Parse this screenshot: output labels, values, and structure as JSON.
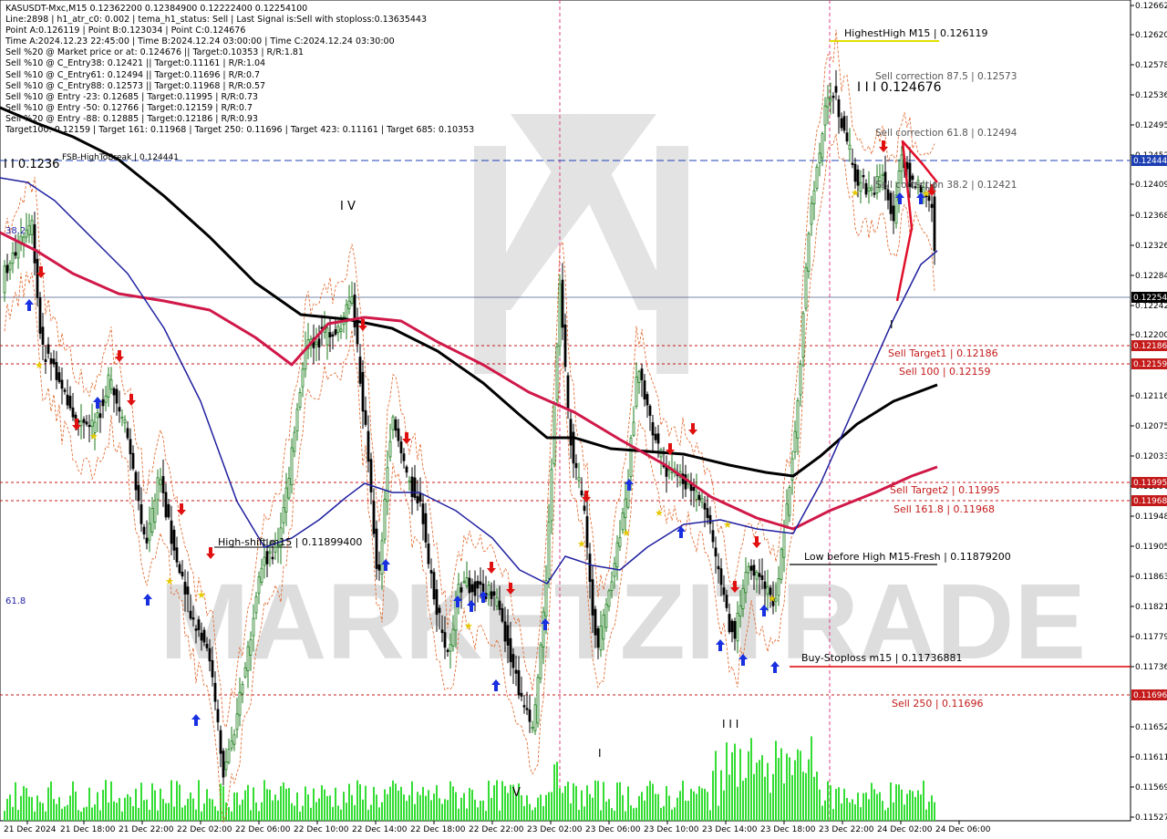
{
  "chart_title": "KASUSDT-Mxc,M15",
  "info_lines": [
    "KASUSDT-Mxc,M15  0.12362200 0.12384900 0.12222400 0.12254100",
    "Line:2898  | h1_atr_c0: 0.002  | tema_h1_status: Sell  | Last Signal is:Sell with stoploss:0.13635443",
    "Point A:0.126119 | Point B:0.123034 | Point C:0.124676",
    "Time A:2024.12.23 22:45:00 | Time B:2024.12.24 03:00:00 | Time C:2024.12.24 03:30:00",
    "Sell %20 @ Market price or at: 0.124676 || Target:0.10353 | R/R:1.81",
    "Sell %10 @ C_Entry38: 0.12421 || Target:0.11161 | R/R:1.04",
    "Sell %10 @ C_Entry61: 0.12494 || Target:0.11696 | R/R:0.7",
    "Sell %10 @ C_Entry88: 0.12573 || Target:0.11968 | R/R:0.57",
    "Sell %10 @ Entry -23: 0.12685 | Target:0.11995 | R/R:0.73",
    "Sell %10 @ Entry -50: 0.12766 | Target:0.12159 | R/R:0.7",
    "Sell %20 @ Entry -88: 0.12885 | Target:0.12186 | R/R:0.93",
    "Target100: 0.12159 | Target 161: 0.11968 | Target 250: 0.11696 | Target 423: 0.11161 | Target 685: 0.10353"
  ],
  "price_axis": {
    "labels": [
      "0.12662",
      "0.12620",
      "0.12578",
      "0.12536",
      "0.12495",
      "0.12452",
      "0.12409",
      "0.12368",
      "0.12326",
      "0.12284",
      "0.12242",
      "0.12200",
      "0.12116",
      "0.12075",
      "0.12033",
      "0.11990",
      "0.11948",
      "0.11905",
      "0.11863",
      "0.11821",
      "0.11779",
      "0.11736",
      "0.11652",
      "0.11611",
      "0.11569",
      "0.11527"
    ],
    "badges": [
      {
        "text": "0.12444",
        "color": "#1c3fb3"
      },
      {
        "text": "0.12254",
        "color": "#000000"
      },
      {
        "text": "0.12186",
        "color": "#c41a1a"
      },
      {
        "text": "0.12159",
        "color": "#c41a1a"
      },
      {
        "text": "0.11995",
        "color": "#c41a1a"
      },
      {
        "text": "0.11968",
        "color": "#c41a1a"
      },
      {
        "text": "0.11696",
        "color": "#c41a1a"
      }
    ]
  },
  "time_axis": {
    "labels": [
      "21 Dec 2024",
      "21 Dec 18:00",
      "21 Dec 22:00",
      "22 Dec 02:00",
      "22 Dec 06:00",
      "22 Dec 10:00",
      "22 Dec 14:00",
      "22 Dec 18:00",
      "22 Dec 22:00",
      "23 Dec 02:00",
      "23 Dec 06:00",
      "23 Dec 10:00",
      "23 Dec 14:00",
      "23 Dec 18:00",
      "23 Dec 22:00",
      "24 Dec 02:00",
      "24 Dec 06:00"
    ]
  },
  "annotations": {
    "highest_high": "HighestHigh   M15 | 0.126119",
    "point_c": "I I I 0.124676",
    "sell_corr_875": "Sell correction 87.5 | 0.12573",
    "sell_corr_618": "Sell correction 61.8 | 0.12494",
    "sell_corr_382": "Sell correction 38.2 | 0.12421",
    "fsb": "FSB-HighToBreak | 0.124441",
    "left_level": "I I 0.1236",
    "iv": "I V",
    "sell_target1": "Sell Target1 | 0.12186",
    "sell_100": "Sell 100 | 0.12159",
    "sell_target2": "Sell Target2 | 0.11995",
    "sell_1618": "Sell 161.8 | 0.11968",
    "high_shift": "High-shift m15 | 0.11899400",
    "low_before_high": "Low before High   M15-Fresh | 0.11879200",
    "buy_stoploss": "Buy-Stoploss m15 | 0.11736881",
    "sell_250": "Sell 250 | 0.11696",
    "v": "V",
    "iii_low": "I I I",
    "i_low": "I",
    "i_right": "I",
    "fib_left": "61.8",
    "fib_left_top": "38.2"
  },
  "watermark": "MARKETZITRADE",
  "colors": {
    "bull": "#1a7a1a",
    "bear": "#000000",
    "ma_black": "#000000",
    "ma_red": "#d01848",
    "ma_blue": "#1f1fa0",
    "level_red": "#c41a1a",
    "fsb_blue": "#1c3fb3",
    "volume": "#33dd33",
    "vline_pink": "#e0408a"
  }
}
